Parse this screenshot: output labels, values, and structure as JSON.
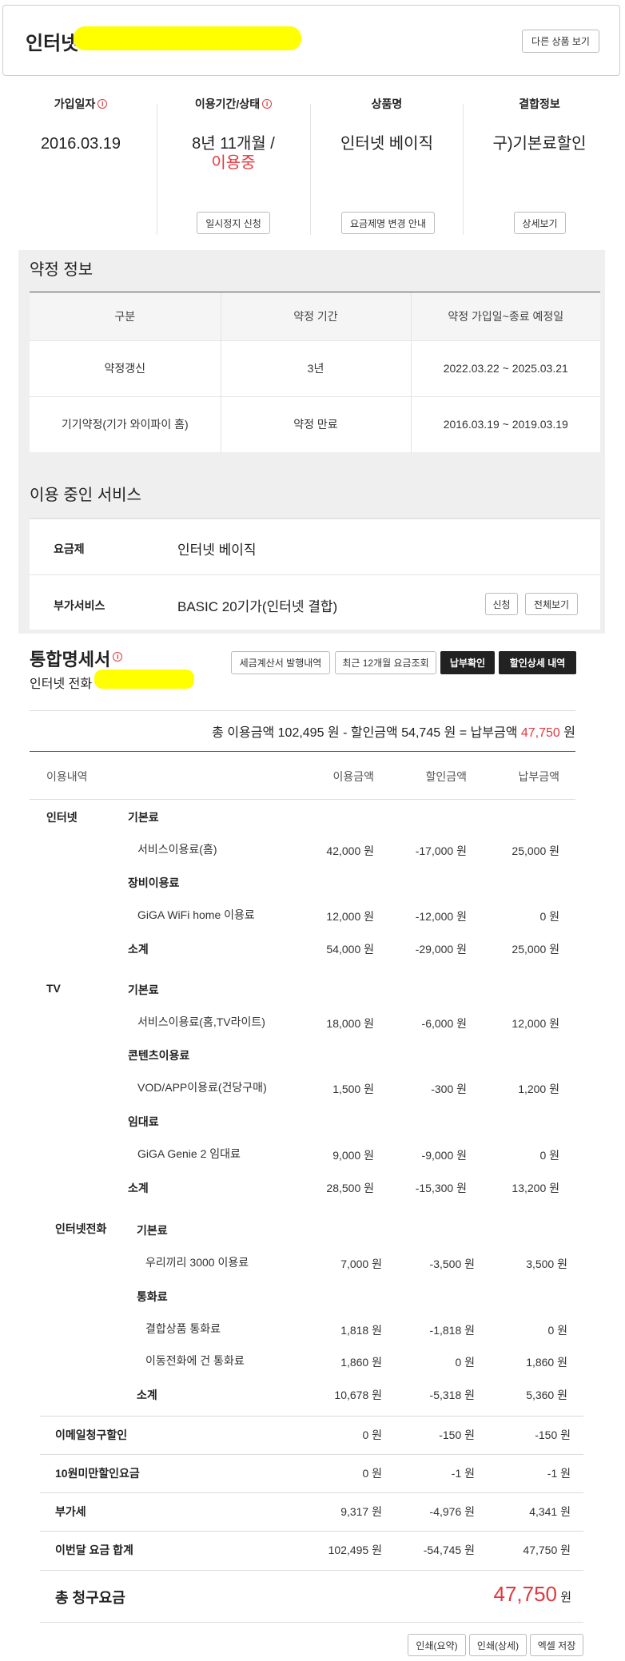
{
  "header": {
    "title": "인터넷",
    "other_products_btn": "다른 상품 보기"
  },
  "summary": {
    "join_date_label": "가입일자",
    "join_date": "2016.03.19",
    "period_label": "이용기간/상태",
    "period_value": "8년 11개월 /",
    "status_value": "이용중",
    "pause_btn": "일시정지 신청",
    "product_label": "상품명",
    "product_value": "인터넷 베이직",
    "plan_change_btn": "요금제명 변경 안내",
    "bundle_label": "결합정보",
    "bundle_value": "구)기본료할인",
    "detail_btn": "상세보기"
  },
  "contract": {
    "title": "약정 정보",
    "headers": [
      "구분",
      "약정 기간",
      "약정 가입일~종료 예정일"
    ],
    "rows": [
      [
        "약정갱신",
        "3년",
        "2022.03.22 ~ 2025.03.21"
      ],
      [
        "기기약정(기가 와이파이 홈)",
        "약정 만료",
        "2016.03.19 ~ 2019.03.19"
      ]
    ]
  },
  "services": {
    "title": "이용 중인 서비스",
    "plan_label": "요금제",
    "plan_value": "인터넷 베이직",
    "addon_label": "부가서비스",
    "addon_value": "BASIC 20기가(인터넷 결합)",
    "apply_btn": "신청",
    "view_all_btn": "전체보기"
  },
  "bill": {
    "title": "통합명세서",
    "subtitle": "인터넷 전화",
    "buttons": [
      "세금계산서 발행내역",
      "최근 12개월 요금조회",
      "납부확인",
      "할인상세 내역"
    ],
    "summary_prefix": "총 이용금액 102,495 원 - 할인금액 54,745 원 = 납부금액",
    "summary_amount": "47,750",
    "summary_unit": "원",
    "col_headers": [
      "이용내역",
      "이용금액",
      "할인금액",
      "납부금액"
    ],
    "internet": {
      "label": "인터넷",
      "basic": "기본료",
      "svc_fee": "서비스이용료(홈)",
      "svc_fee_amts": [
        "42,000 원",
        "-17,000 원",
        "25,000 원"
      ],
      "equip": "장비이용료",
      "wifi": "GiGA WiFi home 이용료",
      "wifi_amts": [
        "12,000 원",
        "-12,000 원",
        "0 원"
      ],
      "subtotal": "소계",
      "subtotal_amts": [
        "54,000 원",
        "-29,000 원",
        "25,000 원"
      ]
    },
    "tv": {
      "label": "TV",
      "basic": "기본료",
      "svc_fee": "서비스이용료(홈,TV라이트)",
      "svc_fee_amts": [
        "18,000 원",
        "-6,000 원",
        "12,000 원"
      ],
      "content": "콘텐츠이용료",
      "vod": "VOD/APP이용료(건당구매)",
      "vod_amts": [
        "1,500 원",
        "-300 원",
        "1,200 원"
      ],
      "rental": "임대료",
      "genie": "GiGA Genie 2 임대료",
      "genie_amts": [
        "9,000 원",
        "-9,000 원",
        "0 원"
      ],
      "subtotal": "소계",
      "subtotal_amts": [
        "28,500 원",
        "-15,300 원",
        "13,200 원"
      ]
    },
    "phone": {
      "label": "인터넷전화",
      "basic": "기본료",
      "woori": "우리끼리 3000 이용료",
      "woori_amts": [
        "7,000 원",
        "-3,500 원",
        "3,500 원"
      ],
      "call": "통화료",
      "bundle_call": "결합상품 통화료",
      "bundle_call_amts": [
        "1,818 원",
        "-1,818 원",
        "0 원"
      ],
      "mobile_call": "이동전화에 건 통화료",
      "mobile_call_amts": [
        "1,860 원",
        "0 원",
        "1,860 원"
      ],
      "subtotal": "소계",
      "subtotal_amts": [
        "10,678 원",
        "-5,318 원",
        "5,360 원"
      ]
    },
    "extras": [
      {
        "label": "이메일청구할인",
        "amts": [
          "0 원",
          "-150 원",
          "-150 원"
        ]
      },
      {
        "label": "10원미만할인요금",
        "amts": [
          "0 원",
          "-1 원",
          "-1 원"
        ]
      },
      {
        "label": "부가세",
        "amts": [
          "9,317 원",
          "-4,976 원",
          "4,341 원"
        ]
      },
      {
        "label": "이번달 요금 합계",
        "amts": [
          "102,495 원",
          "-54,745 원",
          "47,750 원"
        ]
      }
    ],
    "total_label": "총 청구요금",
    "total_amount": "47,750",
    "total_unit": "원",
    "footer_buttons": [
      "인쇄(요약)",
      "인쇄(상세)",
      "엑셀 저장"
    ]
  }
}
